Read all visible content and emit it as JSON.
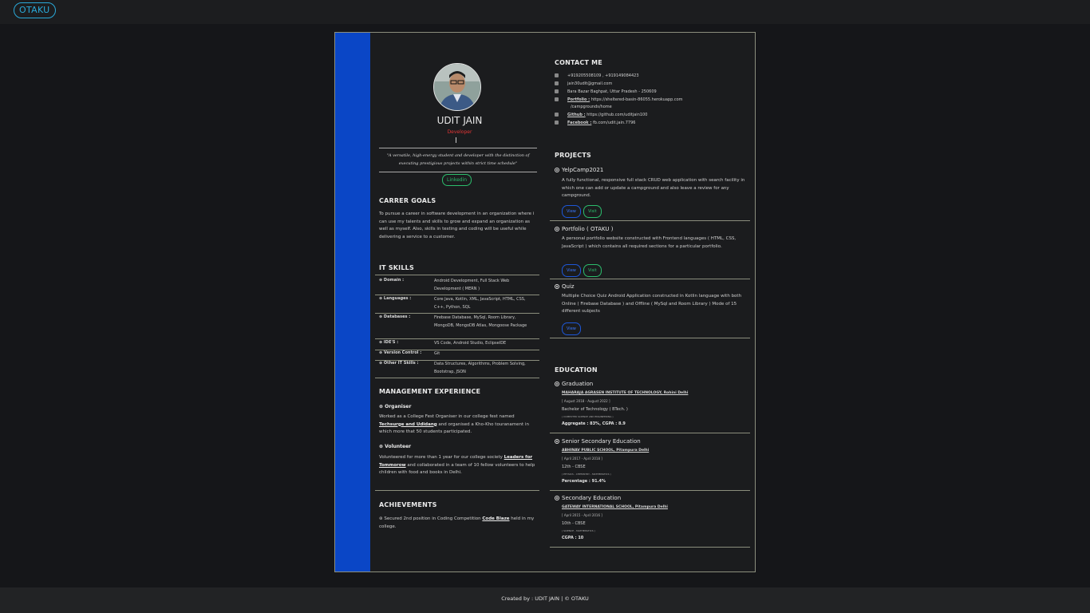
{
  "nav": {
    "brand": "OTAKU"
  },
  "profile": {
    "name": "UDIT JAIN",
    "role": "Developer",
    "quote": "\"A versatile, high-energy student and developer with the distinction of executing prestigious projects within strict time schedule\"",
    "linkedin_label": "Linkedin"
  },
  "career": {
    "heading": "CARRER GOALS",
    "text": "To pursue a career in software development in an organization where i can use my talents and skills to grow and expand an organization as well as myself. Also, skills in testing and coding will be useful while delivering a service to a customer."
  },
  "skills": {
    "heading": "IT SKILLS",
    "rows": [
      {
        "key": "Domain :",
        "value": "Android Development, Full Stack Web Development ( MERN )"
      },
      {
        "key": "Languages :",
        "value": "Core Java, Kotlin, XML, JavaScript, HTML, CSS, C++, Python, SQL"
      },
      {
        "key": "Databases :",
        "value": "Firebase Database, MySql, Room Library, MongoDB, MongoDB Atlas, Mongoose Package"
      },
      {
        "key": "IDE'S :",
        "value": "VS Code, Android Studio, EclipseIDE"
      },
      {
        "key": "Version Control :",
        "value": "Git"
      },
      {
        "key": "Other IT Skills :",
        "value": "Data Structures, Algorithms, Problem Solving, Bootstrap, JSON"
      }
    ]
  },
  "management": {
    "heading": "MANAGEMENT EXPERIENCE",
    "organiser_title": "Organiser",
    "organiser_pre": "Worked as a College Fest Organiser in our college fest named ",
    "organiser_link": "Techsurge and Udidang",
    "organiser_post": " and organised a Kho-Kho touranament in which more that 50 students participated.",
    "volunteer_title": "Volunteer",
    "volunteer_pre": "Volunteered for more than 1 year for our college society ",
    "volunteer_link": "Leaders for Tommorow",
    "volunteer_post": " and collaborated in a team of 10 fellow volunteers to help children with food and books in Delhi."
  },
  "achievements": {
    "heading": "ACHIEVEMENTS",
    "pre": "Secured 2nd position in Coding Competition ",
    "link": "Code Blaze",
    "post": " held in my college."
  },
  "contact": {
    "heading": "CONTACT ME",
    "phone": "+919205508109 , +919149084423",
    "email": "jain30udit@gmail.com",
    "address": "Bara Bazar Baghpat, Uttar Pradesh - 250609",
    "portfolio_label": "Portfolio :",
    "portfolio_url": "https://sheltered-basin-86055.herokuapp.com",
    "portfolio_url2": "/campgrounds/home",
    "github_label": "Github :",
    "github_url": "https://github.com/uditjain100",
    "facebook_label": "Facebook :",
    "facebook_url": "fb.com/udit.jain.7796"
  },
  "projects": {
    "heading": "PROJECTS",
    "items": [
      {
        "title": "YelpCamp2021",
        "desc": "A fully functional, responsive full stack CRUD web application with search facility in which one can add or update a campground and also leave a review for any campground.",
        "view": "View",
        "visit": "Visit"
      },
      {
        "title": "Portfolio ( OTAKU )",
        "desc": "A personal portfolio website constructed with Frontend languages ( HTML, CSS, JavaScript ) which contains all required sections for a particular portfolio.",
        "view": "View",
        "visit": "Visit"
      },
      {
        "title": "Quiz",
        "desc": "Multiple Choice Quiz Android Application constructed in Kotlin language with both Online ( Firebase Database ) and Offline ( MySql and Room Library ) Mode of 15 different subjects",
        "view": "View"
      }
    ]
  },
  "education": {
    "heading": "EDUCATION",
    "items": [
      {
        "title": "Graduation",
        "school": "MAHARAJA AGRASEN INSTITUTE OF TECHNOLOGY, Rohini Delhi",
        "date": "[ August 2018 - August 2022 ]",
        "degree": "Bachelor of Technology ( BTech. )",
        "sub": "( COMPUTER SCIENCE AND ENGINEERING )",
        "score": "Aggregate : 83%, CGPA : 8.9"
      },
      {
        "title": "Senior Secondary Education",
        "school": "ABHINAV PUBLIC SCHOOL, Pitampura Delhi",
        "date": "[ April 2017 - April 2018 ]",
        "degree": "12th - CBSE",
        "sub": "( PHYSICS - CHEMISTRY - MATHEMATICS )",
        "score": "Percentage : 91.4%"
      },
      {
        "title": "Secondary Education",
        "school": "GATEWAY INTERNATIONAL SCHOOL, Pitampura Delhi",
        "date": "[ April 2015 - April 2016 ]",
        "degree": "10th - CBSE",
        "sub": "( SCIENCE - MATHEMATICS )",
        "score": "CGPA : 10"
      }
    ]
  },
  "footer": {
    "text": "Created by : UDIT JAIN | © OTAKU"
  }
}
